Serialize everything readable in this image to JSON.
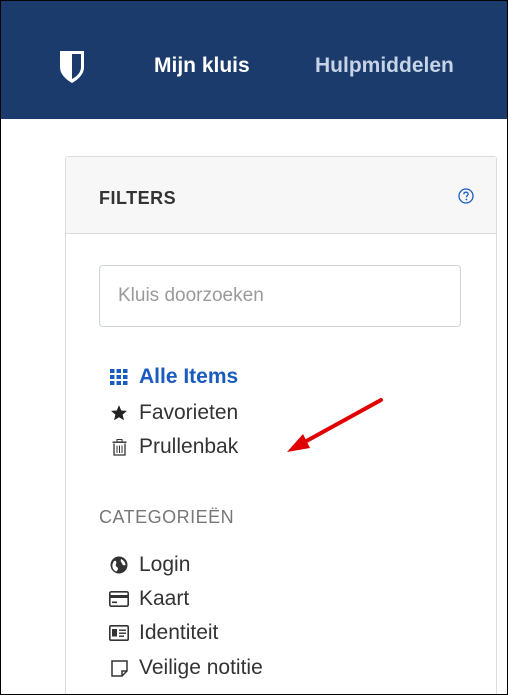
{
  "nav": {
    "logo_icon": "shield-icon",
    "my_vault": "Mijn kluis",
    "tools": "Hulpmiddelen"
  },
  "filters": {
    "title": "FILTERS",
    "help_icon": "question-circle-icon",
    "search_placeholder": "Kluis doorzoeken",
    "search_value": "",
    "items": [
      {
        "label": "Alle Items",
        "icon": "grid-icon",
        "active": true
      },
      {
        "label": "Favorieten",
        "icon": "star-icon",
        "active": false
      },
      {
        "label": "Prullenbak",
        "icon": "trash-icon",
        "active": false
      }
    ],
    "categories_heading": "CATEGORIEËN",
    "categories": [
      {
        "label": "Login",
        "icon": "globe-icon"
      },
      {
        "label": "Kaart",
        "icon": "credit-card-icon"
      },
      {
        "label": "Identiteit",
        "icon": "id-card-icon"
      },
      {
        "label": "Veilige notitie",
        "icon": "sticky-note-icon"
      }
    ]
  },
  "colors": {
    "topbar": "#1a3b6b",
    "active_link": "#1a5bbf",
    "annotation_arrow": "#e00000"
  }
}
